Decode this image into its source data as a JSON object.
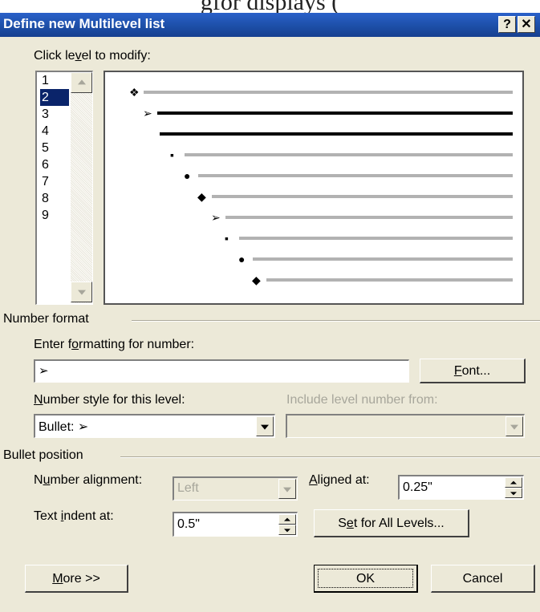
{
  "top_text": "gfor displays (",
  "dialog": {
    "title": "Define new Multilevel list",
    "help_icon": "question-icon",
    "close_icon": "close-icon",
    "click_level_label": "Click level to modify:",
    "levels": [
      "1",
      "2",
      "3",
      "4",
      "5",
      "6",
      "7",
      "8",
      "9"
    ],
    "selected_level": "2",
    "preview": {
      "rows": [
        {
          "bullet": "❖",
          "emphasis": false
        },
        {
          "bullet": "➢",
          "emphasis": true
        },
        {
          "bullet": "",
          "emphasis": true
        },
        {
          "bullet": "▪",
          "emphasis": false
        },
        {
          "bullet": "●",
          "emphasis": false
        },
        {
          "bullet": "◆",
          "emphasis": false
        },
        {
          "bullet": "➢",
          "emphasis": false
        },
        {
          "bullet": "▪",
          "emphasis": false
        },
        {
          "bullet": "●",
          "emphasis": false
        },
        {
          "bullet": "◆",
          "emphasis": false
        }
      ],
      "line_color_normal": "#b2b2b2",
      "line_color_emphasis": "#000000"
    },
    "number_format": {
      "group_label": "Number format",
      "enter_formatting_label": "Enter formatting for number:",
      "formatting_value": "➢",
      "font_button": "Font...",
      "number_style_label": "Number style for this level:",
      "number_style_value": "Bullet: ➢",
      "include_level_label": "Include level number from:",
      "include_level_value": ""
    },
    "bullet_position": {
      "group_label": "Bullet position",
      "number_alignment_label": "Number alignment:",
      "number_alignment_value": "Left",
      "aligned_at_label": "Aligned at:",
      "aligned_at_value": "0.25\"",
      "text_indent_label": "Text indent at:",
      "text_indent_value": "0.5\"",
      "set_all_button": "Set for All Levels..."
    },
    "more_button": "More >>",
    "ok_button": "OK",
    "cancel_button": "Cancel",
    "colors": {
      "titlebar": "#1d4fa8",
      "dialog_bg": "#ece9d8",
      "selection": "#0a246a"
    }
  }
}
